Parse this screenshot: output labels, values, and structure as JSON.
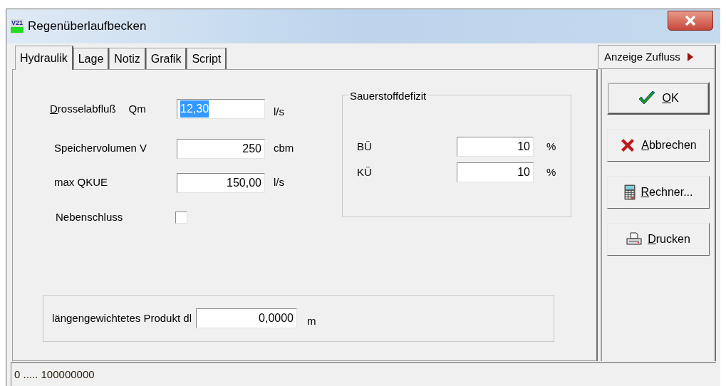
{
  "window": {
    "title": "Regenüberlaufbecken",
    "icon_text": "V21"
  },
  "tabs": [
    {
      "label": "Hydraulik",
      "selected": true
    },
    {
      "label": "Lage",
      "selected": false
    },
    {
      "label": "Notiz",
      "selected": false
    },
    {
      "label": "Grafik",
      "selected": false
    },
    {
      "label": "Script",
      "selected": false
    }
  ],
  "side_tab": {
    "label": "Anzeige Zufluss"
  },
  "fields": [
    {
      "kind": "input",
      "label": "Drosselabfluß",
      "accelerator": true,
      "symbol": "Qm",
      "value": "12,30",
      "unit": "l/s",
      "selected": true
    },
    {
      "kind": "input",
      "label": "Speichervolumen V",
      "accelerator": false,
      "value": "250",
      "unit": "cbm",
      "selected": false
    },
    {
      "kind": "input",
      "label": "max QKUE",
      "accelerator": false,
      "value": "150,00",
      "unit": "l/s",
      "selected": false
    },
    {
      "kind": "checkbox",
      "label": "Nebenschluss",
      "accelerator": false,
      "checked": false
    }
  ],
  "oxygen_group": {
    "title": "Sauerstoffdefizit",
    "fields": [
      {
        "label": "BÜ",
        "value": "10",
        "unit": "%"
      },
      {
        "label": "KÜ",
        "value": "10",
        "unit": "%"
      }
    ]
  },
  "product_group": {
    "label": "längengewichtetes Produkt dl",
    "value": "0,0000",
    "unit": "m"
  },
  "buttons": [
    {
      "kind": "ok",
      "label": "OK",
      "default": true
    },
    {
      "kind": "cancel",
      "label": "Abbrechen",
      "default": false
    },
    {
      "kind": "calculator",
      "label": "Rechner...",
      "default": false
    },
    {
      "kind": "print",
      "label": "Drucken",
      "default": false
    }
  ],
  "status_bar": {
    "text": "0 ..... 100000000"
  }
}
